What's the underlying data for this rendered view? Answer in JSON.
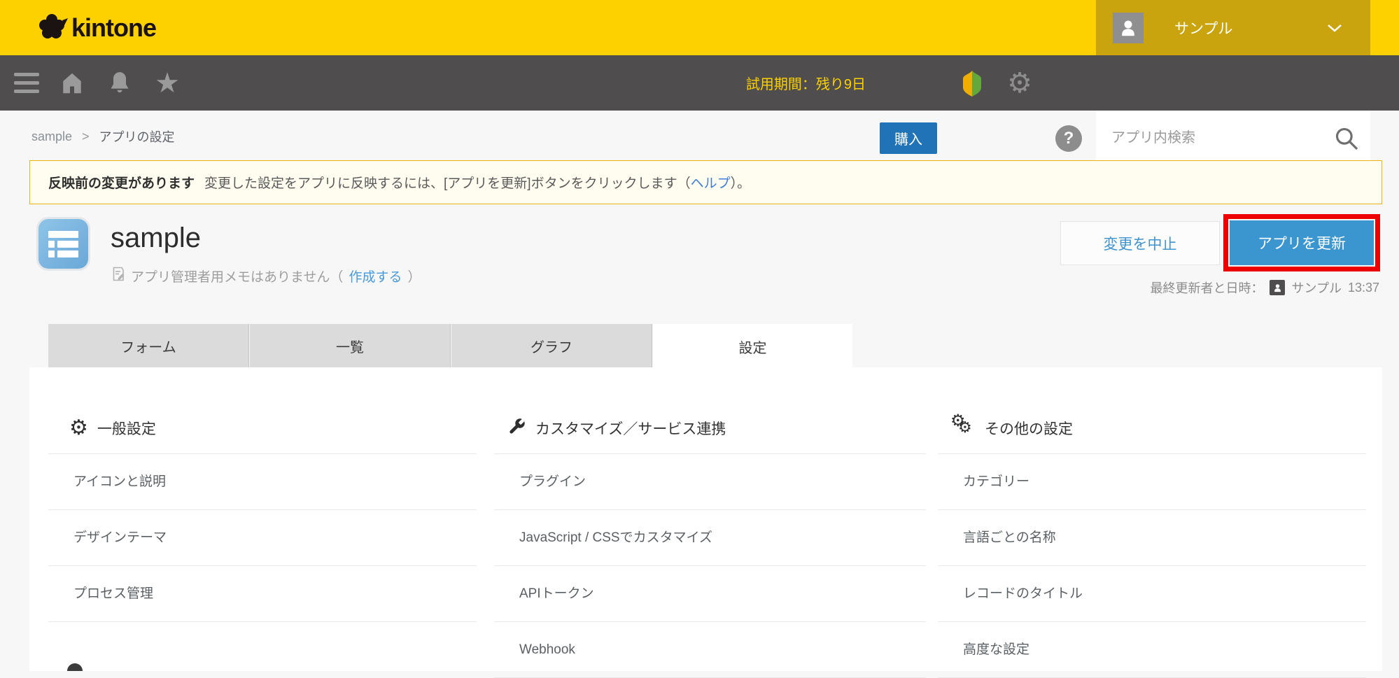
{
  "header": {
    "logo_text": "kintone",
    "user": {
      "name": "サンプル"
    }
  },
  "toolbar": {
    "trial_text": "試用期間：残り9日",
    "buy_label": "購入",
    "search_placeholder": "アプリ内検索"
  },
  "breadcrumb": {
    "app": "sample",
    "separator": ">",
    "page": "アプリの設定"
  },
  "notice": {
    "bold": "反映前の変更があります",
    "text": "変更した設定をアプリに反映するには、[アプリを更新]ボタンをクリックします（",
    "link": "ヘルプ",
    "after": "）。"
  },
  "app": {
    "title": "sample",
    "memo_text": "アプリ管理者用メモはありません（",
    "memo_link": "作成する",
    "memo_after": "）",
    "discard_label": "変更を中止",
    "update_label": "アプリを更新",
    "last_updated_label": "最終更新者と日時：",
    "last_updated_user": "サンプル",
    "last_updated_time": "13:37"
  },
  "tabs": [
    {
      "label": "フォーム",
      "active": false
    },
    {
      "label": "一覧",
      "active": false
    },
    {
      "label": "グラフ",
      "active": false
    },
    {
      "label": "設定",
      "active": true
    }
  ],
  "settings": {
    "columns": [
      {
        "title": "一般設定",
        "icon": "gear-icon",
        "items": [
          "アイコンと説明",
          "デザインテーマ",
          "プロセス管理"
        ]
      },
      {
        "title": "カスタマイズ／サービス連携",
        "icon": "wrench-icon",
        "items": [
          "プラグイン",
          "JavaScript / CSSでカスタマイズ",
          "APIトークン",
          "Webhook"
        ]
      },
      {
        "title": "その他の設定",
        "icon": "gears-icon",
        "items": [
          "カテゴリー",
          "言語ごとの名称",
          "レコードのタイトル",
          "高度な設定"
        ]
      }
    ]
  },
  "colors": {
    "brand_yellow": "#fdd000",
    "user_block_gold": "#c9a40e",
    "toolbar_gray": "#4f4d4d",
    "buy_blue": "#2173b8",
    "update_blue": "#3b96d0",
    "link_blue": "#3f7ed8",
    "highlight_red": "#ec0000",
    "notice_bg": "#fffdf0",
    "notice_border": "#edb216",
    "app_icon_blue": "#7ab4df"
  }
}
